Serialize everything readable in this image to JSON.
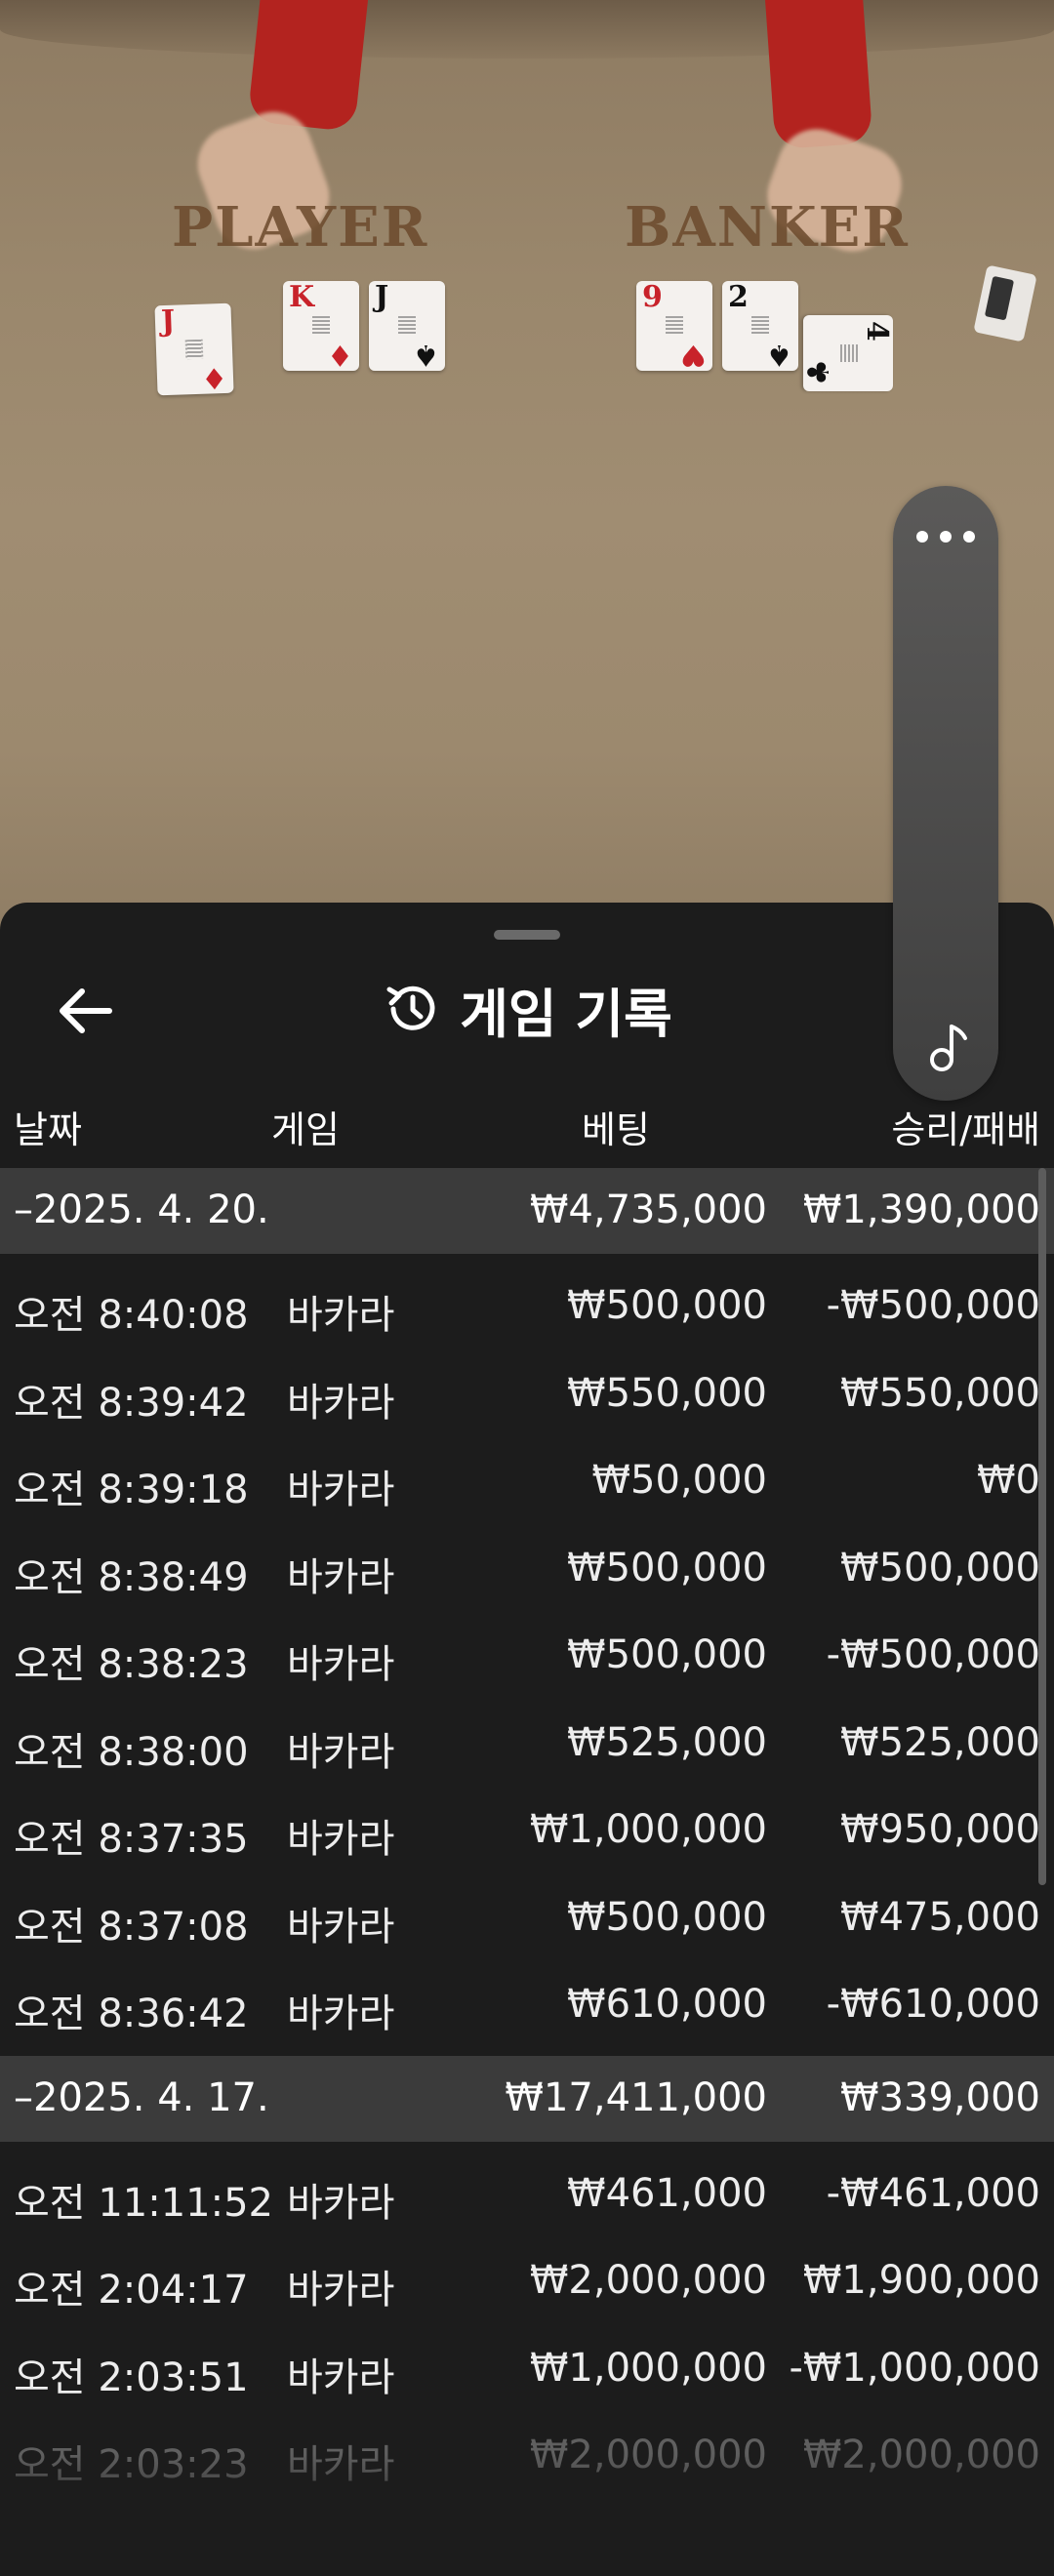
{
  "scene": {
    "player_label": "PLAYER",
    "banker_label": "BANKER",
    "player_cards": [
      {
        "rank": "J",
        "suit": "♦",
        "color": "red"
      },
      {
        "rank": "K",
        "suit": "♦",
        "color": "red"
      },
      {
        "rank": "J",
        "suit": "♠",
        "color": "black"
      }
    ],
    "banker_cards": [
      {
        "rank": "9",
        "suit": "♥",
        "color": "red"
      },
      {
        "rank": "2",
        "suit": "♠",
        "color": "black"
      },
      {
        "rank": "4",
        "suit": "♣",
        "color": "black"
      }
    ]
  },
  "side_controls": {
    "more_icon": "more-horizontal-icon",
    "music_icon": "music-note-icon"
  },
  "header": {
    "back_icon": "arrow-left-icon",
    "history_icon": "history-icon",
    "title": "게임 기록"
  },
  "columns": {
    "date": "날짜",
    "game": "게임",
    "bet": "베팅",
    "result": "승리/패배"
  },
  "groups": [
    {
      "date": "–2025. 4. 20.",
      "total_bet": "₩4,735,000",
      "total_result": "₩1,390,000",
      "rows": [
        {
          "time": "오전 8:40:08",
          "game": "바카라",
          "bet": "₩500,000",
          "result": "-₩500,000"
        },
        {
          "time": "오전 8:39:42",
          "game": "바카라",
          "bet": "₩550,000",
          "result": "₩550,000"
        },
        {
          "time": "오전 8:39:18",
          "game": "바카라",
          "bet": "₩50,000",
          "result": "₩0"
        },
        {
          "time": "오전 8:38:49",
          "game": "바카라",
          "bet": "₩500,000",
          "result": "₩500,000"
        },
        {
          "time": "오전 8:38:23",
          "game": "바카라",
          "bet": "₩500,000",
          "result": "-₩500,000"
        },
        {
          "time": "오전 8:38:00",
          "game": "바카라",
          "bet": "₩525,000",
          "result": "₩525,000"
        },
        {
          "time": "오전 8:37:35",
          "game": "바카라",
          "bet": "₩1,000,000",
          "result": "₩950,000"
        },
        {
          "time": "오전 8:37:08",
          "game": "바카라",
          "bet": "₩500,000",
          "result": "₩475,000"
        },
        {
          "time": "오전 8:36:42",
          "game": "바카라",
          "bet": "₩610,000",
          "result": "-₩610,000"
        }
      ]
    },
    {
      "date": "–2025. 4. 17.",
      "total_bet": "₩17,411,000",
      "total_result": "₩339,000",
      "rows": [
        {
          "time": "오전 11:11:52",
          "game": "바카라",
          "bet": "₩461,000",
          "result": "-₩461,000"
        },
        {
          "time": "오전 2:04:17",
          "game": "바카라",
          "bet": "₩2,000,000",
          "result": "₩1,900,000"
        },
        {
          "time": "오전 2:03:51",
          "game": "바카라",
          "bet": "₩1,000,000",
          "result": "-₩1,000,000"
        },
        {
          "time": "오전 2:03:23",
          "game": "바카라",
          "bet": "₩2,000,000",
          "result": "₩2,000,000"
        }
      ]
    }
  ]
}
